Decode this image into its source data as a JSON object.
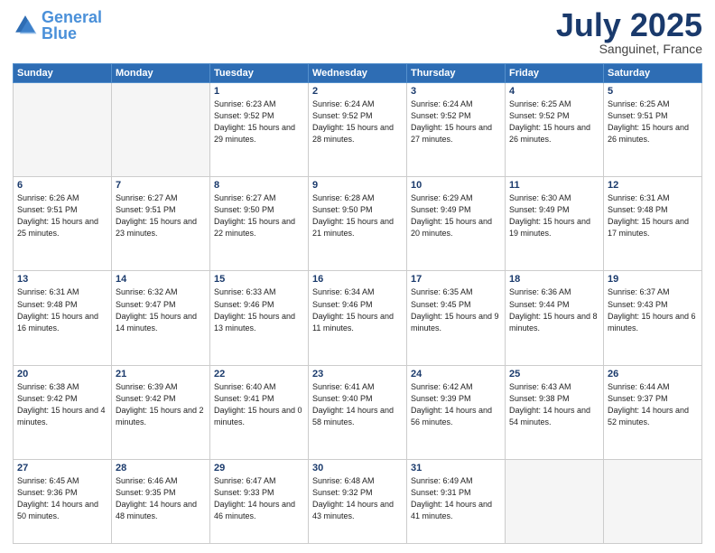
{
  "logo": {
    "text_general": "General",
    "text_blue": "Blue"
  },
  "header": {
    "month": "July 2025",
    "location": "Sanguinet, France"
  },
  "weekdays": [
    "Sunday",
    "Monday",
    "Tuesday",
    "Wednesday",
    "Thursday",
    "Friday",
    "Saturday"
  ],
  "weeks": [
    [
      {
        "day": "",
        "empty": true
      },
      {
        "day": "",
        "empty": true
      },
      {
        "day": "1",
        "sunrise": "6:23 AM",
        "sunset": "9:52 PM",
        "daylight": "15 hours and 29 minutes."
      },
      {
        "day": "2",
        "sunrise": "6:24 AM",
        "sunset": "9:52 PM",
        "daylight": "15 hours and 28 minutes."
      },
      {
        "day": "3",
        "sunrise": "6:24 AM",
        "sunset": "9:52 PM",
        "daylight": "15 hours and 27 minutes."
      },
      {
        "day": "4",
        "sunrise": "6:25 AM",
        "sunset": "9:52 PM",
        "daylight": "15 hours and 26 minutes."
      },
      {
        "day": "5",
        "sunrise": "6:25 AM",
        "sunset": "9:51 PM",
        "daylight": "15 hours and 26 minutes."
      }
    ],
    [
      {
        "day": "6",
        "sunrise": "6:26 AM",
        "sunset": "9:51 PM",
        "daylight": "15 hours and 25 minutes."
      },
      {
        "day": "7",
        "sunrise": "6:27 AM",
        "sunset": "9:51 PM",
        "daylight": "15 hours and 23 minutes."
      },
      {
        "day": "8",
        "sunrise": "6:27 AM",
        "sunset": "9:50 PM",
        "daylight": "15 hours and 22 minutes."
      },
      {
        "day": "9",
        "sunrise": "6:28 AM",
        "sunset": "9:50 PM",
        "daylight": "15 hours and 21 minutes."
      },
      {
        "day": "10",
        "sunrise": "6:29 AM",
        "sunset": "9:49 PM",
        "daylight": "15 hours and 20 minutes."
      },
      {
        "day": "11",
        "sunrise": "6:30 AM",
        "sunset": "9:49 PM",
        "daylight": "15 hours and 19 minutes."
      },
      {
        "day": "12",
        "sunrise": "6:31 AM",
        "sunset": "9:48 PM",
        "daylight": "15 hours and 17 minutes."
      }
    ],
    [
      {
        "day": "13",
        "sunrise": "6:31 AM",
        "sunset": "9:48 PM",
        "daylight": "15 hours and 16 minutes."
      },
      {
        "day": "14",
        "sunrise": "6:32 AM",
        "sunset": "9:47 PM",
        "daylight": "15 hours and 14 minutes."
      },
      {
        "day": "15",
        "sunrise": "6:33 AM",
        "sunset": "9:46 PM",
        "daylight": "15 hours and 13 minutes."
      },
      {
        "day": "16",
        "sunrise": "6:34 AM",
        "sunset": "9:46 PM",
        "daylight": "15 hours and 11 minutes."
      },
      {
        "day": "17",
        "sunrise": "6:35 AM",
        "sunset": "9:45 PM",
        "daylight": "15 hours and 9 minutes."
      },
      {
        "day": "18",
        "sunrise": "6:36 AM",
        "sunset": "9:44 PM",
        "daylight": "15 hours and 8 minutes."
      },
      {
        "day": "19",
        "sunrise": "6:37 AM",
        "sunset": "9:43 PM",
        "daylight": "15 hours and 6 minutes."
      }
    ],
    [
      {
        "day": "20",
        "sunrise": "6:38 AM",
        "sunset": "9:42 PM",
        "daylight": "15 hours and 4 minutes."
      },
      {
        "day": "21",
        "sunrise": "6:39 AM",
        "sunset": "9:42 PM",
        "daylight": "15 hours and 2 minutes."
      },
      {
        "day": "22",
        "sunrise": "6:40 AM",
        "sunset": "9:41 PM",
        "daylight": "15 hours and 0 minutes."
      },
      {
        "day": "23",
        "sunrise": "6:41 AM",
        "sunset": "9:40 PM",
        "daylight": "14 hours and 58 minutes."
      },
      {
        "day": "24",
        "sunrise": "6:42 AM",
        "sunset": "9:39 PM",
        "daylight": "14 hours and 56 minutes."
      },
      {
        "day": "25",
        "sunrise": "6:43 AM",
        "sunset": "9:38 PM",
        "daylight": "14 hours and 54 minutes."
      },
      {
        "day": "26",
        "sunrise": "6:44 AM",
        "sunset": "9:37 PM",
        "daylight": "14 hours and 52 minutes."
      }
    ],
    [
      {
        "day": "27",
        "sunrise": "6:45 AM",
        "sunset": "9:36 PM",
        "daylight": "14 hours and 50 minutes."
      },
      {
        "day": "28",
        "sunrise": "6:46 AM",
        "sunset": "9:35 PM",
        "daylight": "14 hours and 48 minutes."
      },
      {
        "day": "29",
        "sunrise": "6:47 AM",
        "sunset": "9:33 PM",
        "daylight": "14 hours and 46 minutes."
      },
      {
        "day": "30",
        "sunrise": "6:48 AM",
        "sunset": "9:32 PM",
        "daylight": "14 hours and 43 minutes."
      },
      {
        "day": "31",
        "sunrise": "6:49 AM",
        "sunset": "9:31 PM",
        "daylight": "14 hours and 41 minutes."
      },
      {
        "day": "",
        "empty": true
      },
      {
        "day": "",
        "empty": true
      }
    ]
  ]
}
